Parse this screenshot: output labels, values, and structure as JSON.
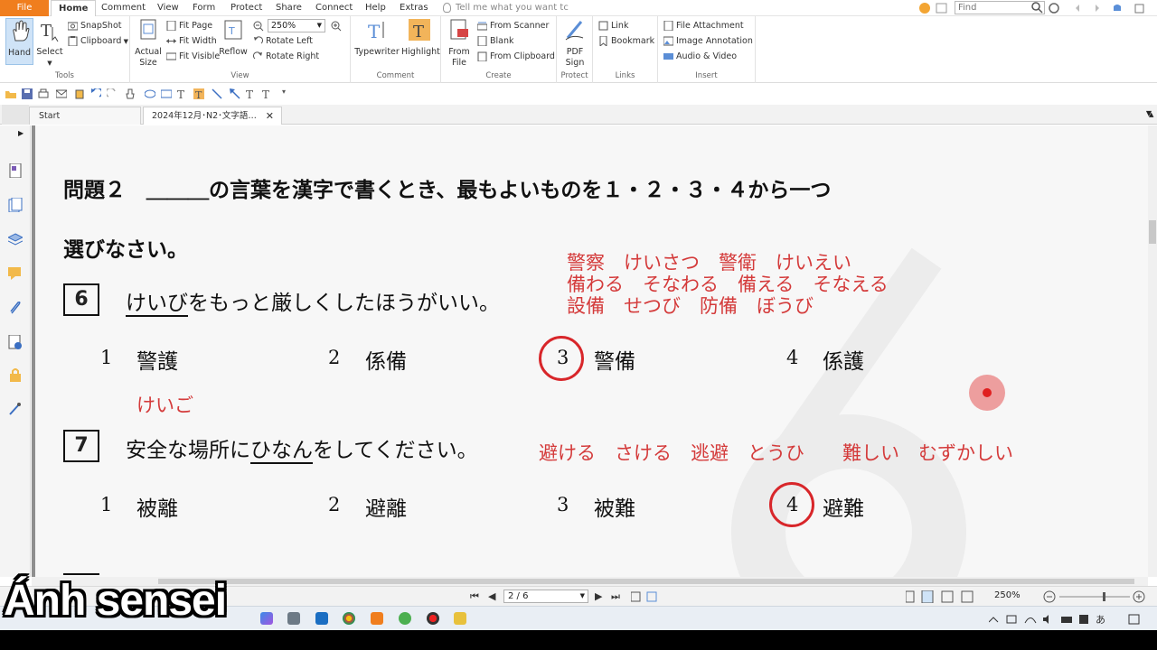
{
  "menu": {
    "file": "File",
    "items": [
      "Home",
      "Comment",
      "View",
      "Form",
      "Protect",
      "Share",
      "Connect",
      "Help",
      "Extras"
    ],
    "tell_me": "Tell me what you want tc",
    "find_placeholder": "Find"
  },
  "ribbon": {
    "tools": {
      "label": "Tools",
      "hand": "Hand",
      "select": "Select",
      "snapshot": "SnapShot",
      "clipboard": "Clipboard"
    },
    "view": {
      "label": "View",
      "actual_size": "Actual Size",
      "fit_page": "Fit Page",
      "fit_width": "Fit Width",
      "fit_visible": "Fit Visible",
      "reflow": "Reflow",
      "zoom": "250%",
      "rotate_left": "Rotate Left",
      "rotate_right": "Rotate Right"
    },
    "comment": {
      "label": "Comment",
      "typewriter": "Typewriter",
      "highlight": "Highlight"
    },
    "create": {
      "label": "Create",
      "from_file": "From File",
      "from_scanner": "From Scanner",
      "blank": "Blank",
      "from_clipboard": "From Clipboard"
    },
    "protect": {
      "label": "Protect",
      "pdf_sign": "PDF Sign"
    },
    "links": {
      "label": "Links",
      "link": "Link",
      "bookmark": "Bookmark"
    },
    "insert": {
      "label": "Insert",
      "file_attachment": "File Attachment",
      "image_annotation": "Image Annotation",
      "audio_video": "Audio & Video"
    }
  },
  "tabs": {
    "start": "Start",
    "doc": "2024年12月･N2･文字語…"
  },
  "doc": {
    "heading_line1": "問題２　＿＿＿の言葉を漢字で書くとき、最もよいものを１・２・３・４から一つ",
    "heading_line2": "選びなさい。",
    "q6": {
      "num": "6",
      "underlined": "けいび",
      "rest": "をもっと厳しくしたほうがいい。",
      "options": [
        {
          "num": "1",
          "text": "警護"
        },
        {
          "num": "2",
          "text": "係備"
        },
        {
          "num": "3",
          "text": "警備"
        },
        {
          "num": "4",
          "text": "係護"
        }
      ],
      "answer": "3",
      "notes": [
        "警察　けいさつ　警衛　けいえい",
        "備わる　そなわる　備える　そなえる",
        "設備　せつび　防備　ぼうび"
      ],
      "note_under_1": "けいご"
    },
    "q7": {
      "num": "7",
      "pre": "安全な場所に",
      "underlined": "ひなん",
      "rest": "をしてください。",
      "options": [
        {
          "num": "1",
          "text": "被離"
        },
        {
          "num": "2",
          "text": "避離"
        },
        {
          "num": "3",
          "text": "被難"
        },
        {
          "num": "4",
          "text": "避難"
        }
      ],
      "answer": "4",
      "notes": "避ける　さける　逃避　とうひ　　難しい　むずかしい"
    }
  },
  "status": {
    "page": "2 / 6",
    "zoom": "250%"
  },
  "caption": "Ánh sensei",
  "colors": {
    "accent": "#f07e1e",
    "annotation_red": "#d43b3b",
    "circle_red": "#d8262a"
  }
}
